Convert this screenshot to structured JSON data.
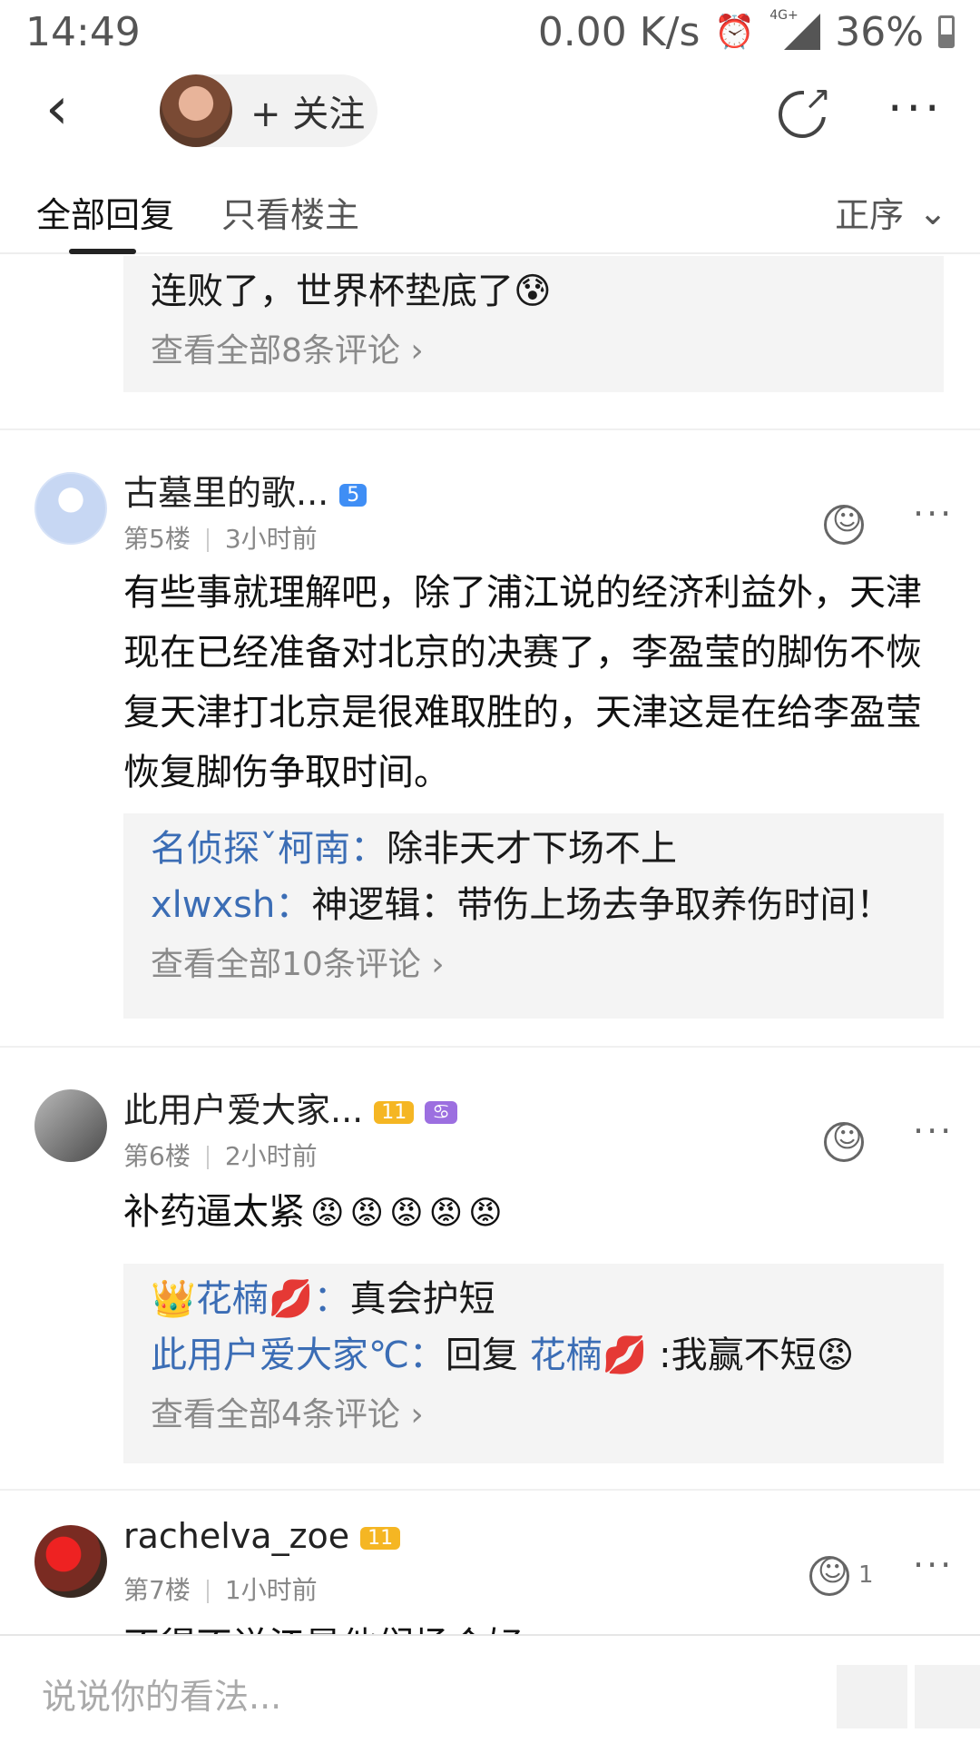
{
  "status": {
    "time": "14:49",
    "speed": "0.00 K/s",
    "network": "4G+",
    "battery": "36%"
  },
  "nav": {
    "follow_label": "+ 关注"
  },
  "tabs": {
    "all": "全部回复",
    "op_only": "只看楼主",
    "sort": "正序"
  },
  "prev_floor": {
    "reply_tail": "连败了，世界杯垫底了😰",
    "view_all": "查看全部8条评论"
  },
  "floors": [
    {
      "username": "古墓里的歌...",
      "level_badge": "5",
      "floor_no": "第5楼",
      "time": "3小时前",
      "content": "有些事就理解吧，除了浦江说的经济利益外，天津现在已经准备对北京的决赛了，李盈莹的脚伤不恢复天津打北京是很难取胜的，天津这是在给李盈莹恢复脚伤争取时间。",
      "replies": [
        {
          "user": "名侦探ˇ柯南：",
          "text": "除非天才下场不上"
        },
        {
          "user": "xlwxsh：",
          "text": "神逻辑：带伤上场去争取养伤时间！"
        }
      ],
      "view_all": "查看全部10条评论"
    },
    {
      "username": "此用户爱大家...",
      "level_badge": "11",
      "extra_badge": "♋",
      "floor_no": "第6楼",
      "time": "2小时前",
      "content": "补药逼太紧",
      "emojis": [
        "😡",
        "😡",
        "😡",
        "😡",
        "😡"
      ],
      "replies": [
        {
          "user": "👑花楠💋：",
          "text": "真会护短"
        },
        {
          "user": "此用户爱大家℃：",
          "text": "回复 ",
          "user2": "花楠💋",
          "text2": " :我赢不短😡"
        }
      ],
      "view_all": "查看全部4条评论"
    },
    {
      "username": "rachelva_zoe",
      "level_badge": "11",
      "floor_no": "第7楼",
      "time": "1小时前",
      "react_count": "1",
      "content": "不得不说江是他们场合好..."
    }
  ],
  "input": {
    "placeholder": "说说你的看法..."
  }
}
